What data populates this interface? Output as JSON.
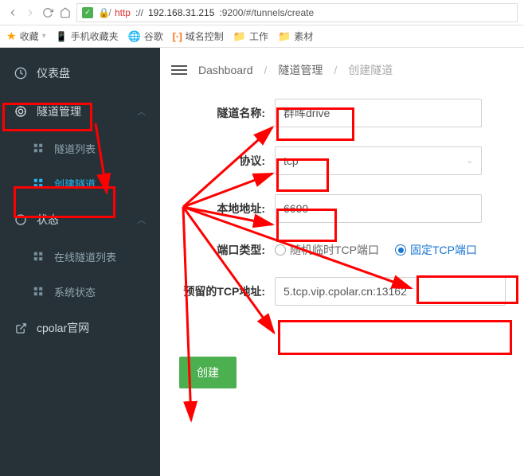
{
  "browser": {
    "url_scheme": "http",
    "url_rest": "://",
    "url_host": "192.168.31.215",
    "url_port_path": ":9200/#/tunnels/create"
  },
  "bookmarks": {
    "fav": "收藏",
    "mobile": "手机收藏夹",
    "google": "谷歌",
    "domain": "域名控制",
    "work": "工作",
    "material": "素材"
  },
  "sidebar": {
    "dashboard": "仪表盘",
    "tunnels": "隧道管理",
    "tunnel_list": "隧道列表",
    "tunnel_create": "创建隧道",
    "status": "状态",
    "online_list": "在线隧道列表",
    "sys_status": "系统状态",
    "cpolar": "cpolar官网"
  },
  "breadcrumb": {
    "b1": "Dashboard",
    "b2": "隧道管理",
    "b3": "创建隧道"
  },
  "form": {
    "name_label": "隧道名称:",
    "name_value": "群晖drive",
    "proto_label": "协议:",
    "proto_value": "tcp",
    "addr_label": "本地地址:",
    "addr_value": "6690",
    "port_type_label": "端口类型:",
    "radio_random": "随机临时TCP端口",
    "radio_fixed": "固定TCP端口",
    "reserved_label": "预留的TCP地址:",
    "reserved_value": "5.tcp.vip.cpolar.cn:13162",
    "create_btn": "创建"
  }
}
